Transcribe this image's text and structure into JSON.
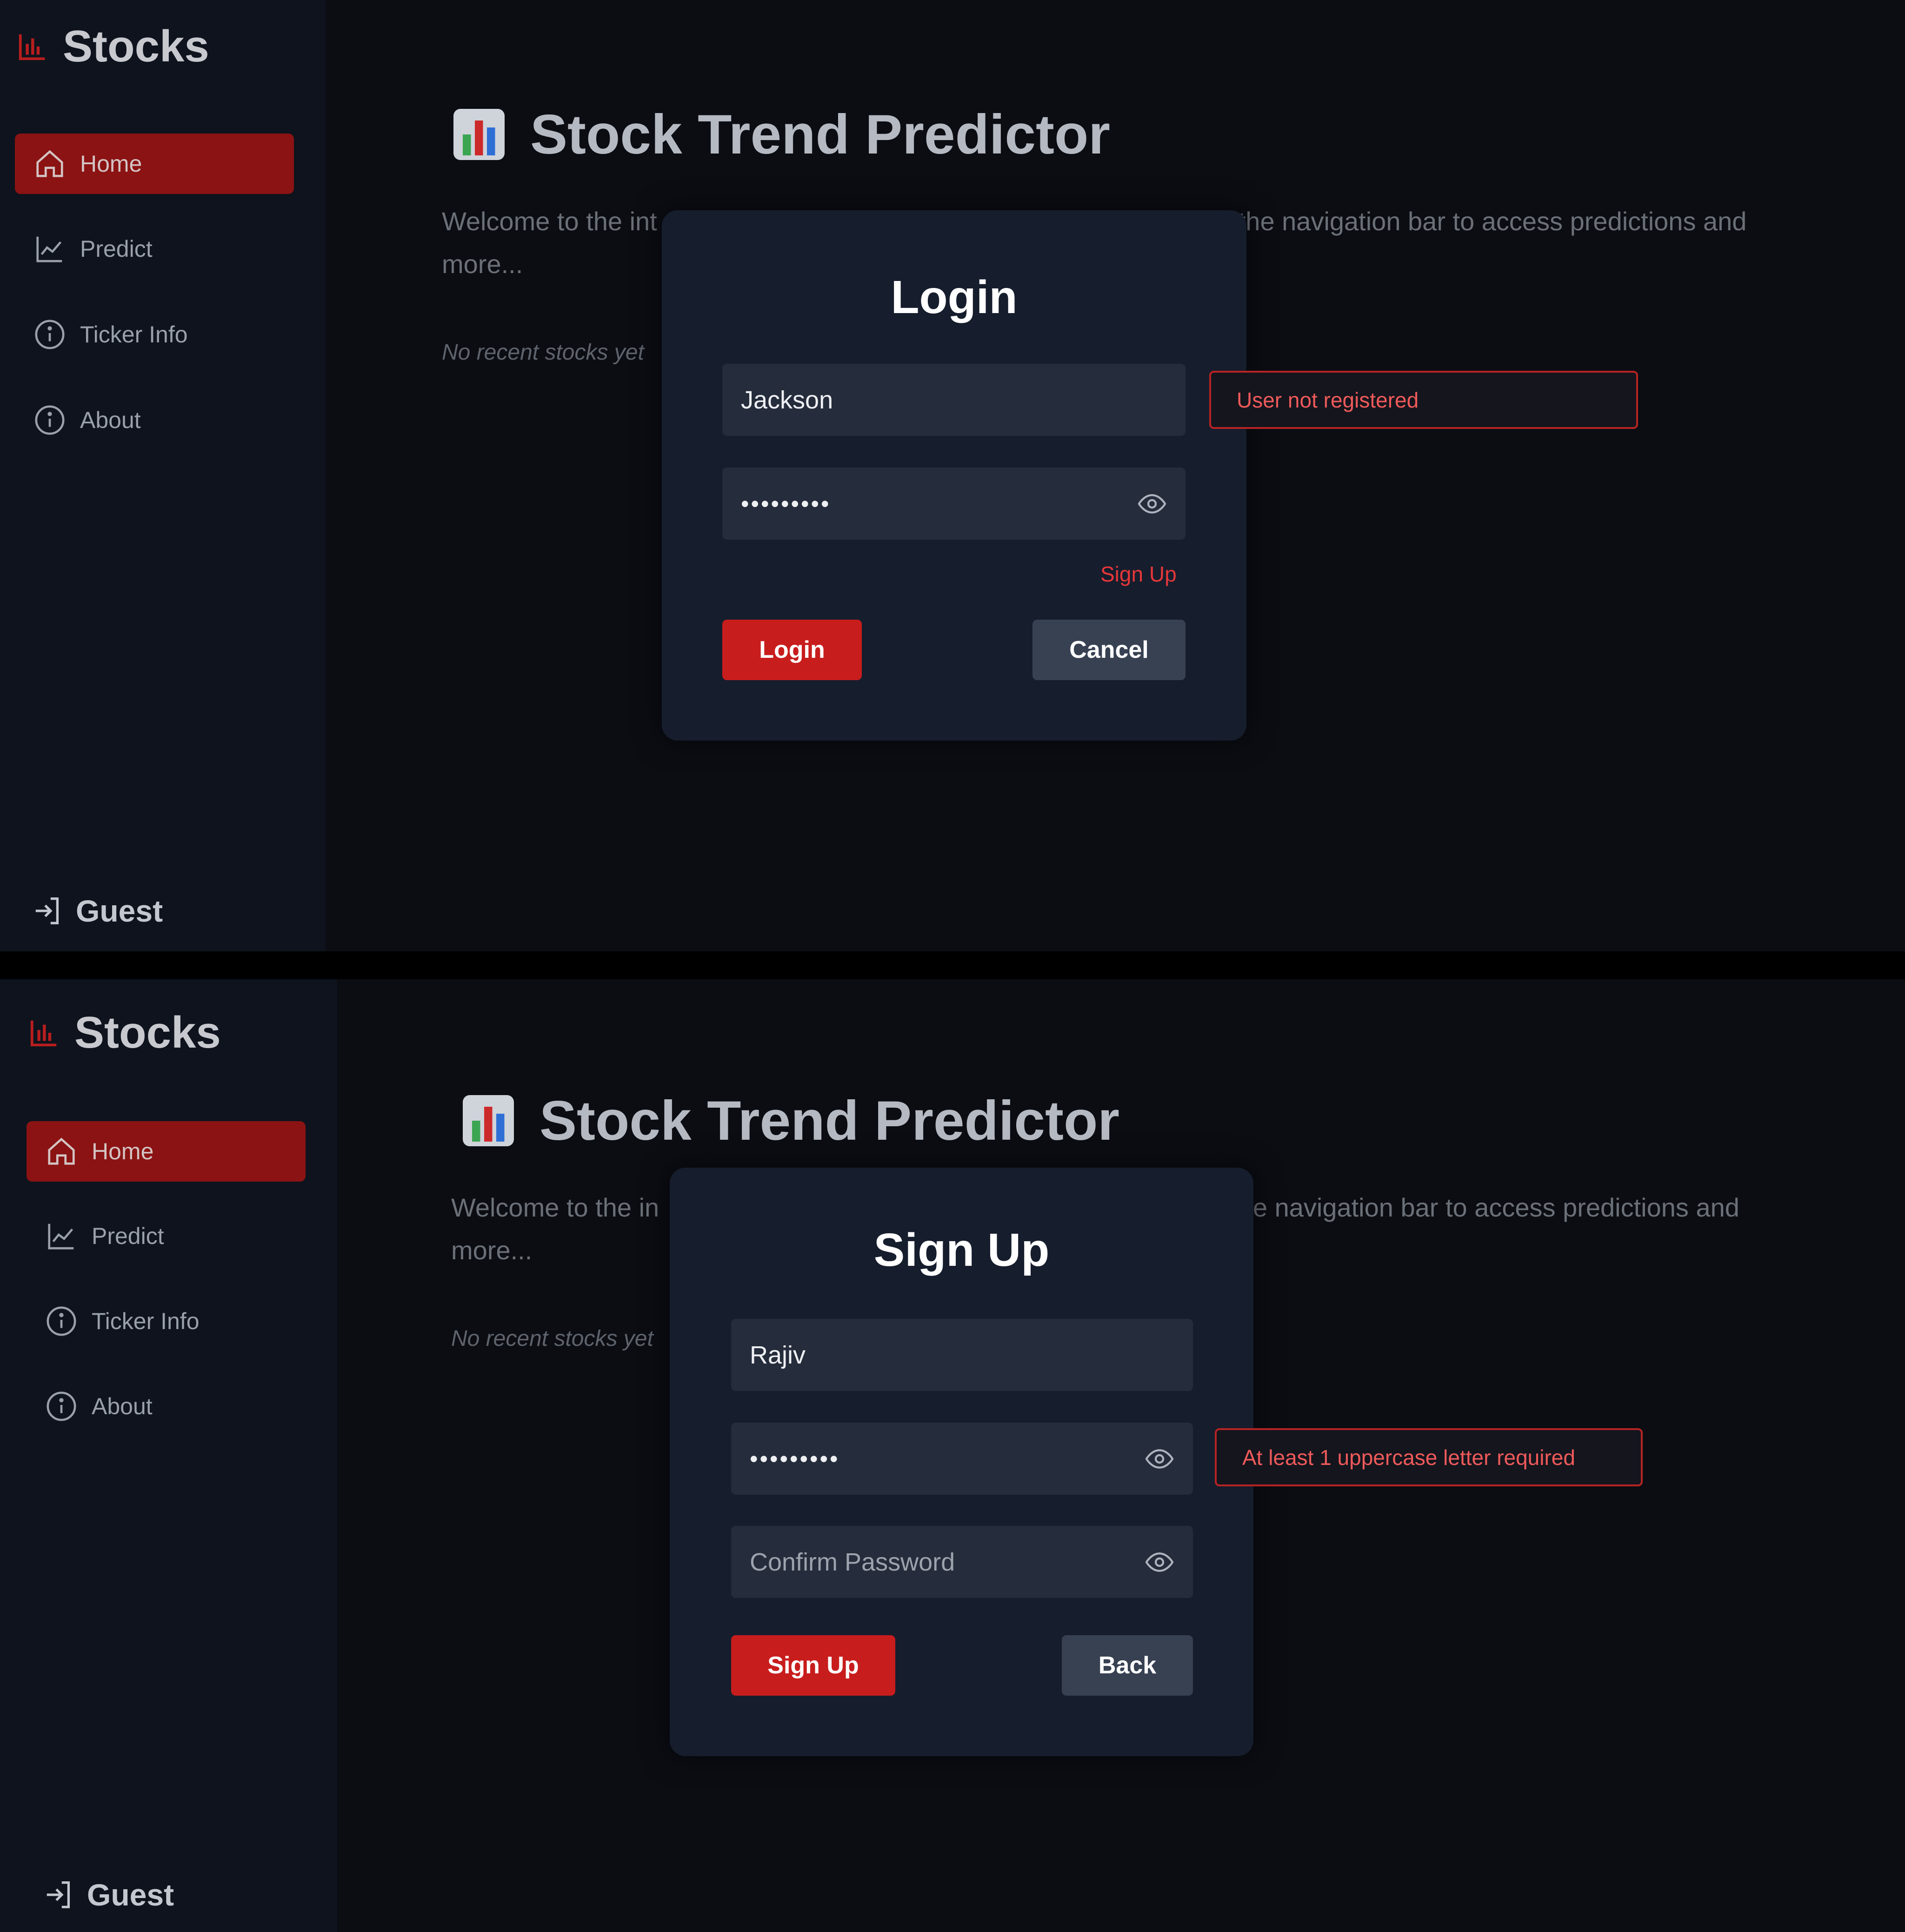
{
  "app": {
    "brand": "Stocks",
    "nav": [
      {
        "label": "Home",
        "icon": "home-icon",
        "active": true
      },
      {
        "label": "Predict",
        "icon": "line-chart-icon"
      },
      {
        "label": "Ticker Info",
        "icon": "info-circle-icon"
      },
      {
        "label": "About",
        "icon": "info-circle-icon"
      }
    ],
    "user": "Guest",
    "page_title": "Stock Trend Predictor",
    "welcome_left": "Welcome to the in",
    "welcome_left_top": "Welcome to the int",
    "welcome_right": "the navigation bar to access predictions and",
    "welcome_line2": "more...",
    "recent": "No recent stocks yet"
  },
  "login": {
    "title": "Login",
    "username": "Jackson",
    "password_masked": "•••••••••",
    "signup_link": "Sign Up",
    "login_button": "Login",
    "cancel_button": "Cancel",
    "error": "User not registered"
  },
  "signup": {
    "title": "Sign Up",
    "username": "Rajiv",
    "password_masked": "•••••••••",
    "confirm_placeholder": "Confirm Password",
    "signup_button": "Sign Up",
    "back_button": "Back",
    "error": "At least 1 uppercase letter required"
  },
  "colors": {
    "accent": "#c81d1d",
    "nav_active": "#8b1313",
    "modal_bg": "#161d2d",
    "field_bg": "#252c3b",
    "error_text": "#ef5a5a"
  }
}
